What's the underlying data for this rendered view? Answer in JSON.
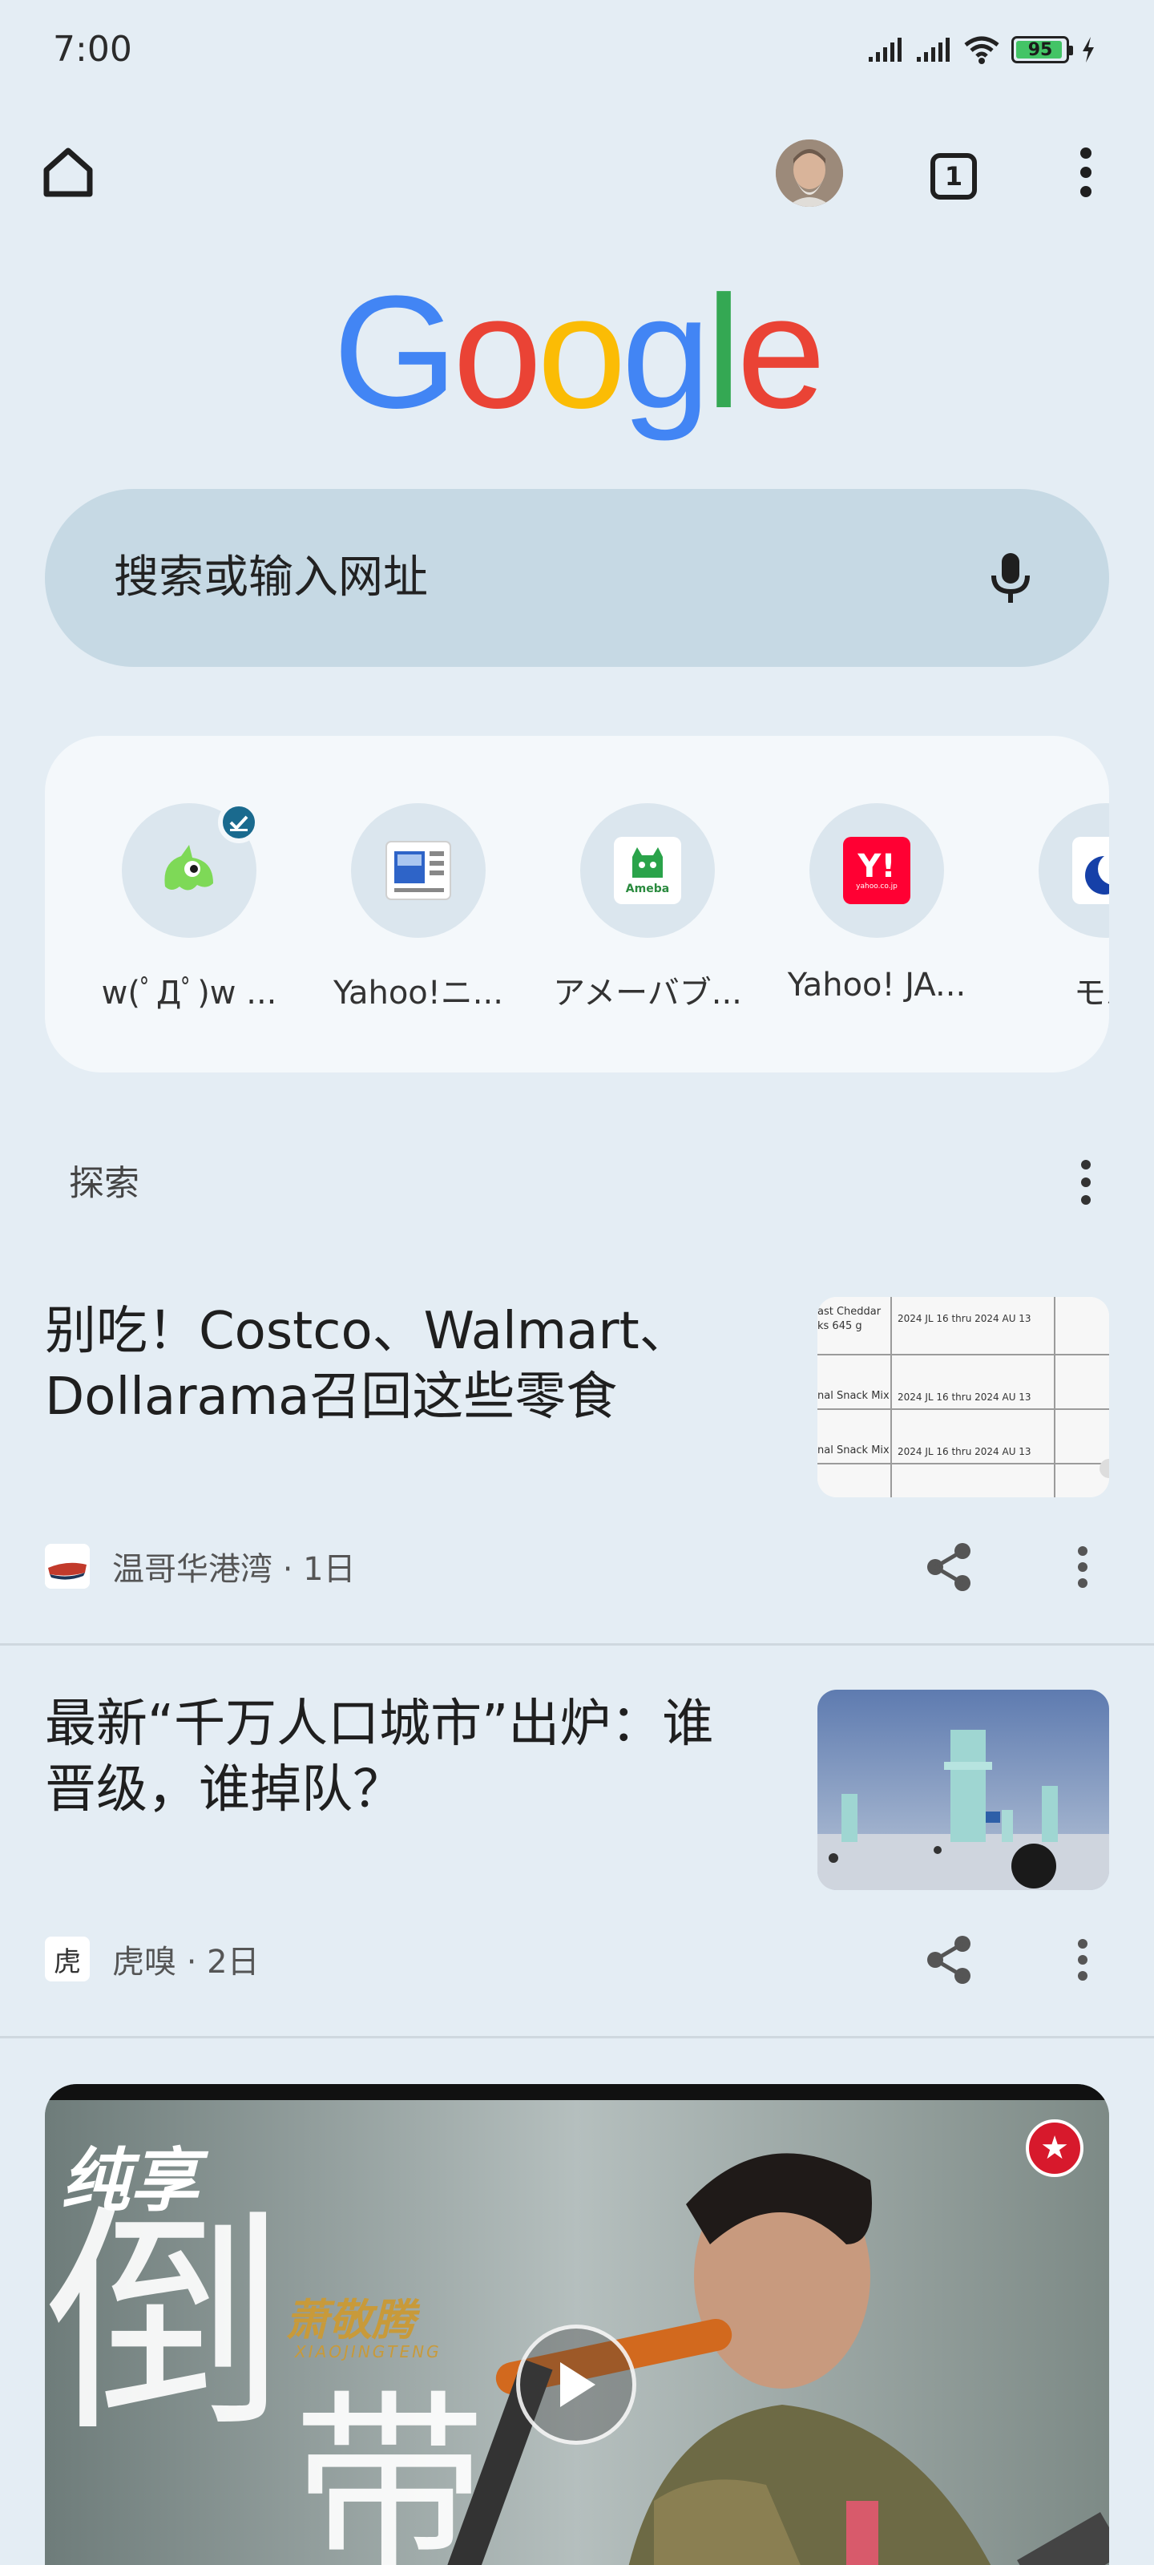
{
  "status_bar": {
    "time": "7:00",
    "battery": "95",
    "battery_level": 0.95,
    "icons": [
      "signal-icon",
      "signal-icon",
      "wifi-icon",
      "battery-icon",
      "charging-icon"
    ]
  },
  "toolbar": {
    "tab_count": "1",
    "icons": [
      "home-icon",
      "avatar",
      "tab-switcher-icon",
      "more-vert-icon"
    ]
  },
  "logo": {
    "letters": [
      "G",
      "o",
      "o",
      "g",
      "l",
      "e"
    ],
    "colors": [
      "#4285f4",
      "#ea4335",
      "#fbbc05",
      "#4285f4",
      "#34a853",
      "#ea4335"
    ]
  },
  "search": {
    "placeholder": "搜索或输入网址",
    "icon": "mic-icon"
  },
  "shortcuts": [
    {
      "label": "w(ﾟДﾟ)w ...",
      "icon": "green-monster-icon",
      "badge": "check-icon"
    },
    {
      "label": "Yahoo!ニ...",
      "icon": "news-icon"
    },
    {
      "label": "アメーバブ...",
      "icon": "ameba-icon",
      "icon_text": "Ameba"
    },
    {
      "label": "Yahoo! JA...",
      "icon": "yahoo-icon",
      "icon_text": "Y!",
      "icon_subtext": "yahoo.co.jp"
    },
    {
      "label": "モバ",
      "icon": "moon-icon"
    }
  ],
  "discover": {
    "label": "探索"
  },
  "articles": [
    {
      "title_line1": "别吃！Costco、Walmart、",
      "title_line2": "Dollarama召回这些零食",
      "source": "温哥华港湾 · 1日",
      "thumb_rows": [
        {
          "left": "ast Cheddar",
          "left2": "ks 645 g",
          "right": "2024 JL 16 thru 2024 AU 13"
        },
        {
          "left": "nal Snack Mix",
          "right": "2024 JL 16 thru 2024 AU 13"
        },
        {
          "left": "nal Snack Mix",
          "right": "2024 JL 16 thru 2024 AU 13"
        }
      ]
    },
    {
      "title_line1": "最新“千万人口城市”出炉：谁",
      "title_line2": "晋级，谁掉队？",
      "source": "虎嗅 · 2日",
      "source_icon_text": "虎"
    }
  ],
  "video": {
    "tag": "纯享",
    "big_char_1": "倒",
    "big_char_2": "带",
    "artist": "萧敬腾",
    "artist_latin": "XIAOJINGTENG",
    "icons": [
      "play-icon",
      "channel-logo-icon"
    ]
  }
}
